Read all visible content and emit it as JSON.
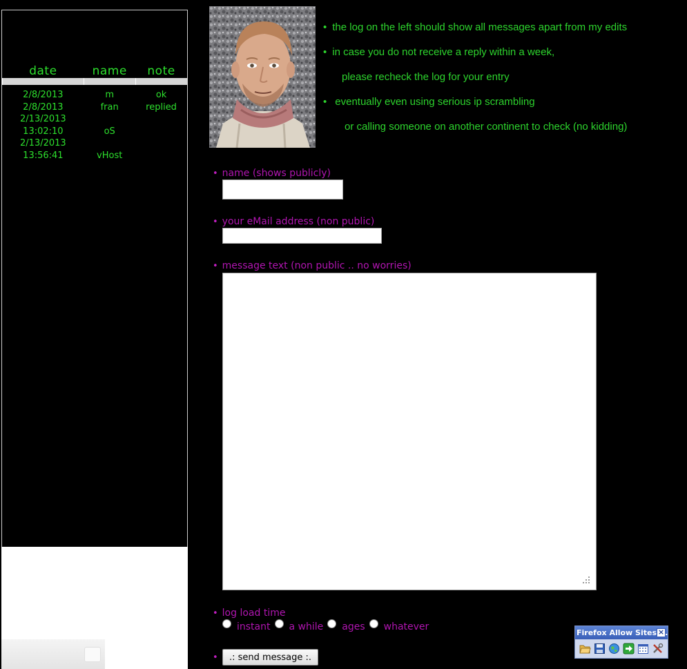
{
  "log": {
    "headers": [
      "date",
      "name",
      "note"
    ],
    "rows": [
      {
        "date": "2/8/2013",
        "name": "m",
        "note": "ok"
      },
      {
        "date": "2/8/2013",
        "name": "fran",
        "note": "replied"
      },
      {
        "date": "2/13/2013",
        "time": "13:02:10",
        "name": "oS",
        "note": ""
      },
      {
        "date": "2/13/2013",
        "time": "13:56:41",
        "name": "vHost",
        "note": ""
      }
    ]
  },
  "info": {
    "line1": "the log on the left should show all messages apart from my edits",
    "line2": "in case you do not receive a reply within a week,",
    "line3": "please recheck the log for your entry",
    "line4": "eventually even using serious ip scrambling",
    "line5": "or calling someone on another continent to check (no kidding)"
  },
  "form": {
    "name_label": "name (shows publicly)",
    "name_value": "",
    "email_label": "your eMail address (non public)",
    "email_value": "",
    "message_label": "message text (non public .. no worries)",
    "message_value": "",
    "load_label": "log load time",
    "options": [
      "instant",
      "a while",
      "ages",
      "whatever"
    ],
    "send_label": ".: send message :."
  },
  "widget": {
    "title": "Firefox Allow Sites ...",
    "close": "×"
  },
  "colors": {
    "green": "#2dd42d",
    "purple": "#b015b0",
    "background": "#000000"
  }
}
